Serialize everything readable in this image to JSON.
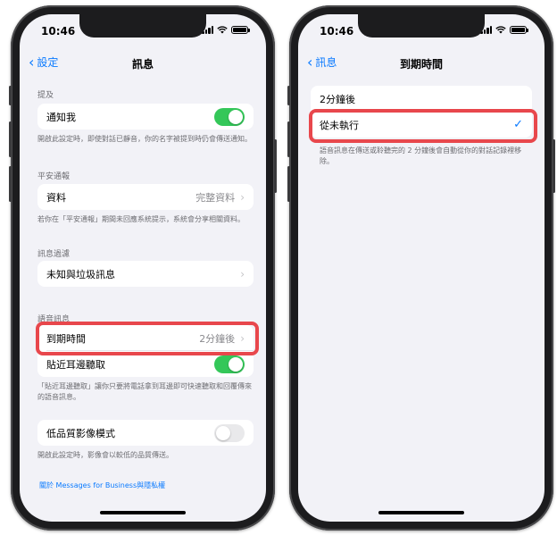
{
  "left": {
    "status_time": "10:46",
    "back_label": "設定",
    "title": "訊息",
    "mentions": {
      "header": "提及",
      "notify_label": "通知我",
      "notify_on": true,
      "footer": "開啟此設定時，即使對話已靜音，你的名字被提到時仍會傳送通知。"
    },
    "safety": {
      "header": "平安通報",
      "data_label": "資料",
      "data_value": "完整資料",
      "footer": "若你在「平安通報」期間未回應系統提示，系統會分享相關資料。"
    },
    "filter": {
      "header": "訊息過濾",
      "unknown_label": "未知與垃圾訊息"
    },
    "audio": {
      "header": "語音訊息",
      "expire_label": "到期時間",
      "expire_value": "2分鐘後",
      "raise_label": "貼近耳邊聽取",
      "raise_on": true,
      "footer": "「貼近耳邊聽取」讓你只要將電話拿到耳邊即可快速聽取和回覆傳來的語音訊息。"
    },
    "low_quality": {
      "label": "低品質影像模式",
      "on": false,
      "footer": "開啟此設定時，影像會以較低的品質傳送。"
    },
    "link": "關於 Messages for Business與隱私權"
  },
  "right": {
    "status_time": "10:46",
    "back_label": "訊息",
    "title": "到期時間",
    "options": [
      "2分鐘後",
      "從未執行"
    ],
    "selected_index": 1,
    "footer": "語音訊息在傳送或聆聽完的 2 分鐘後會自動從你的對話記錄裡移除。"
  },
  "colors": {
    "accent": "#0a7aff",
    "toggle_on": "#34c759",
    "highlight": "#e8474c"
  }
}
